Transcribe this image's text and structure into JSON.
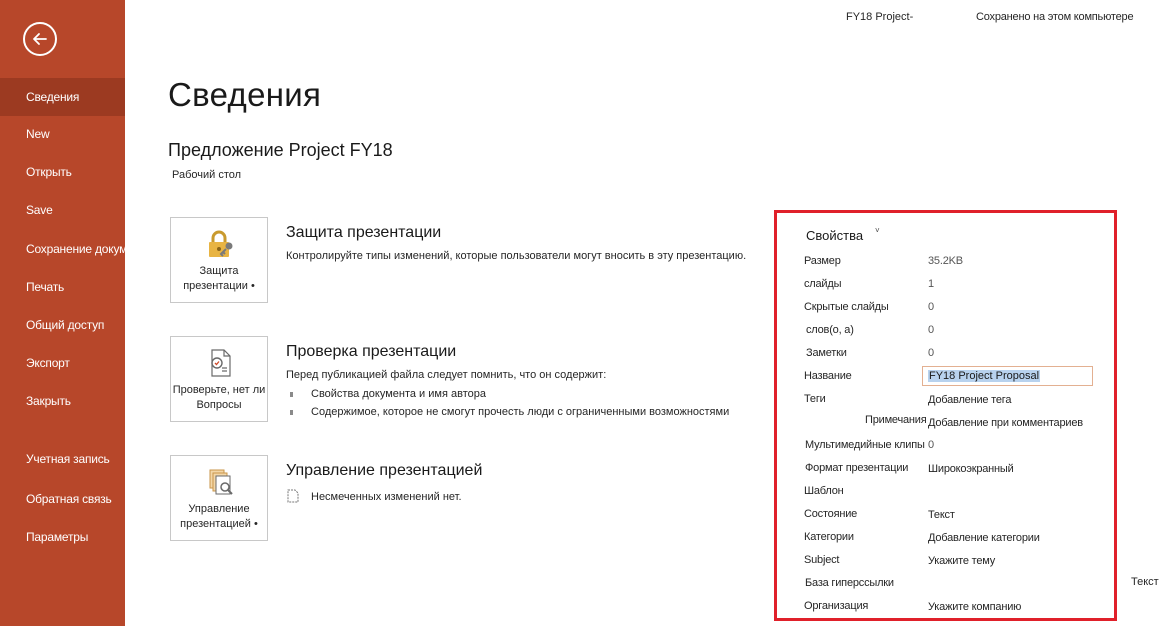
{
  "accent_color": "#b7472a",
  "highlight_color": "#e0202a",
  "header": {
    "file_title": "FY18 Project-",
    "save_status": "Сохранено на этом компьютере"
  },
  "sidebar": {
    "back_icon": "back-arrow-icon",
    "items": [
      {
        "label": "Сведения",
        "active": true
      },
      {
        "label": "New"
      },
      {
        "label": "Открыть"
      },
      {
        "label": "Save"
      },
      {
        "label": "Сохранение документа"
      },
      {
        "label": "Печать"
      },
      {
        "label": "Общий доступ"
      },
      {
        "label": "Экспорт"
      },
      {
        "label": "Закрыть"
      },
      {
        "label": "Учетная запись"
      },
      {
        "label": "Обратная связь"
      },
      {
        "label": "Параметры"
      }
    ]
  },
  "main": {
    "title": "Сведения",
    "doc_name": "Предложение Project FY18",
    "doc_location": "Рабочий стол",
    "sections": [
      {
        "tile_label_1": "Защита",
        "tile_label_2": "презентации •",
        "heading": "Защита презентации",
        "text": "Контролируйте типы изменений, которые пользователи могут вносить в эту презентацию.",
        "icon": "lock-key-icon"
      },
      {
        "tile_label_1": "Проверьте, нет ли",
        "tile_label_2": "Вопросы",
        "heading": "Проверка презентации",
        "text": "Перед публикацией файла следует помнить, что он содержит:",
        "bullets": [
          "Свойства документа и имя автора",
          "Содержимое, которое не смогут прочесть люди с ограниченными возможностями"
        ],
        "icon": "inspect-document-icon"
      },
      {
        "tile_label_1": "Управление",
        "tile_label_2": "презентацией •",
        "heading": "Управление презентацией",
        "text": "Несмеченных изменений нет.",
        "icon": "manage-document-icon"
      }
    ]
  },
  "properties": {
    "heading": "Свойства",
    "caret": "˅",
    "rows": [
      {
        "label": "Размер",
        "value": "35.2KB"
      },
      {
        "label": "слайды",
        "value": "1"
      },
      {
        "label": "Скрытые слайды",
        "value": "0"
      },
      {
        "label": "слов(о, а)",
        "value": "0"
      },
      {
        "label": "Заметки",
        "value": "0"
      },
      {
        "label": "Название",
        "value": "FY18 Project Proposal"
      },
      {
        "label": "Теги",
        "value": "Добавление тега"
      },
      {
        "label": "Примечания",
        "value": "Добавление при комментариев"
      },
      {
        "label": "Мультимедийные клипы",
        "value": "0"
      },
      {
        "label": "Формат презентации",
        "value": "Широкоэкранный"
      },
      {
        "label": "Шаблон",
        "value": ""
      },
      {
        "label": "Состояние",
        "value": "Текст"
      },
      {
        "label": "Категории",
        "value": "Добавление категории"
      },
      {
        "label": "Subject",
        "value": "Укажите тему"
      },
      {
        "label": "База гиперссылки",
        "value": "Текст"
      },
      {
        "label": "Организация",
        "value": "Укажите компанию"
      }
    ]
  }
}
